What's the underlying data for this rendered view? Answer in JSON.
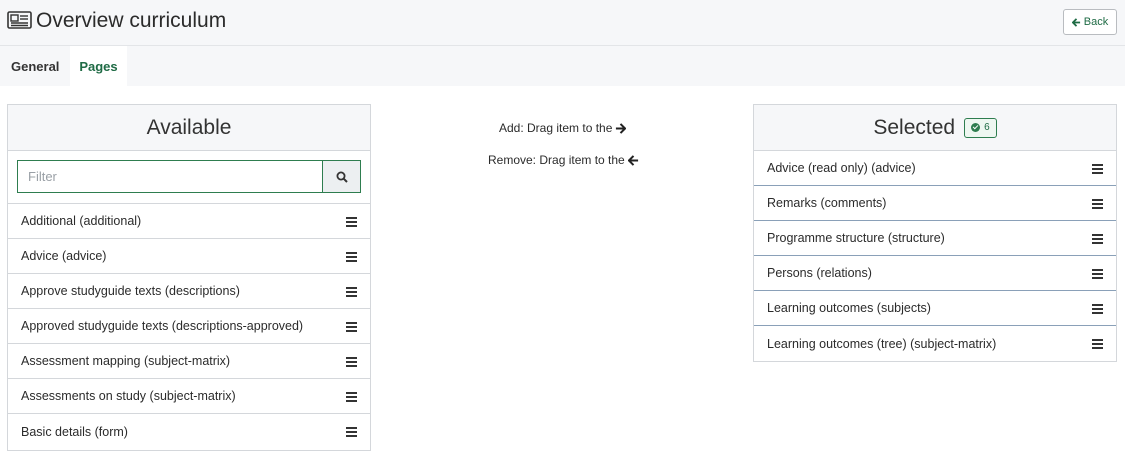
{
  "header": {
    "title": "Overview curriculum",
    "title_icon": "newspaper-icon",
    "back_label": "Back"
  },
  "tabs": [
    {
      "label": "General",
      "active": false
    },
    {
      "label": "Pages",
      "active": true
    }
  ],
  "available": {
    "title": "Available",
    "filter_placeholder": "Filter",
    "items": [
      "Additional (additional)",
      "Advice (advice)",
      "Approve studyguide texts (descriptions)",
      "Approved studyguide texts (descriptions-approved)",
      "Assessment mapping (subject-matrix)",
      "Assessments on study (subject-matrix)",
      "Basic details (form)"
    ]
  },
  "hints": {
    "add": "Add: Drag item to the",
    "remove": "Remove: Drag item to the"
  },
  "selected": {
    "title": "Selected",
    "count": "6",
    "items": [
      "Advice (read only) (advice)",
      "Remarks (comments)",
      "Programme structure (structure)",
      "Persons (relations)",
      "Learning outcomes (subjects)",
      "Learning outcomes (tree) (subject-matrix)"
    ]
  },
  "colors": {
    "accent": "#1f6b45",
    "border": "#d4d7db",
    "header_bg": "#f6f7f9"
  }
}
